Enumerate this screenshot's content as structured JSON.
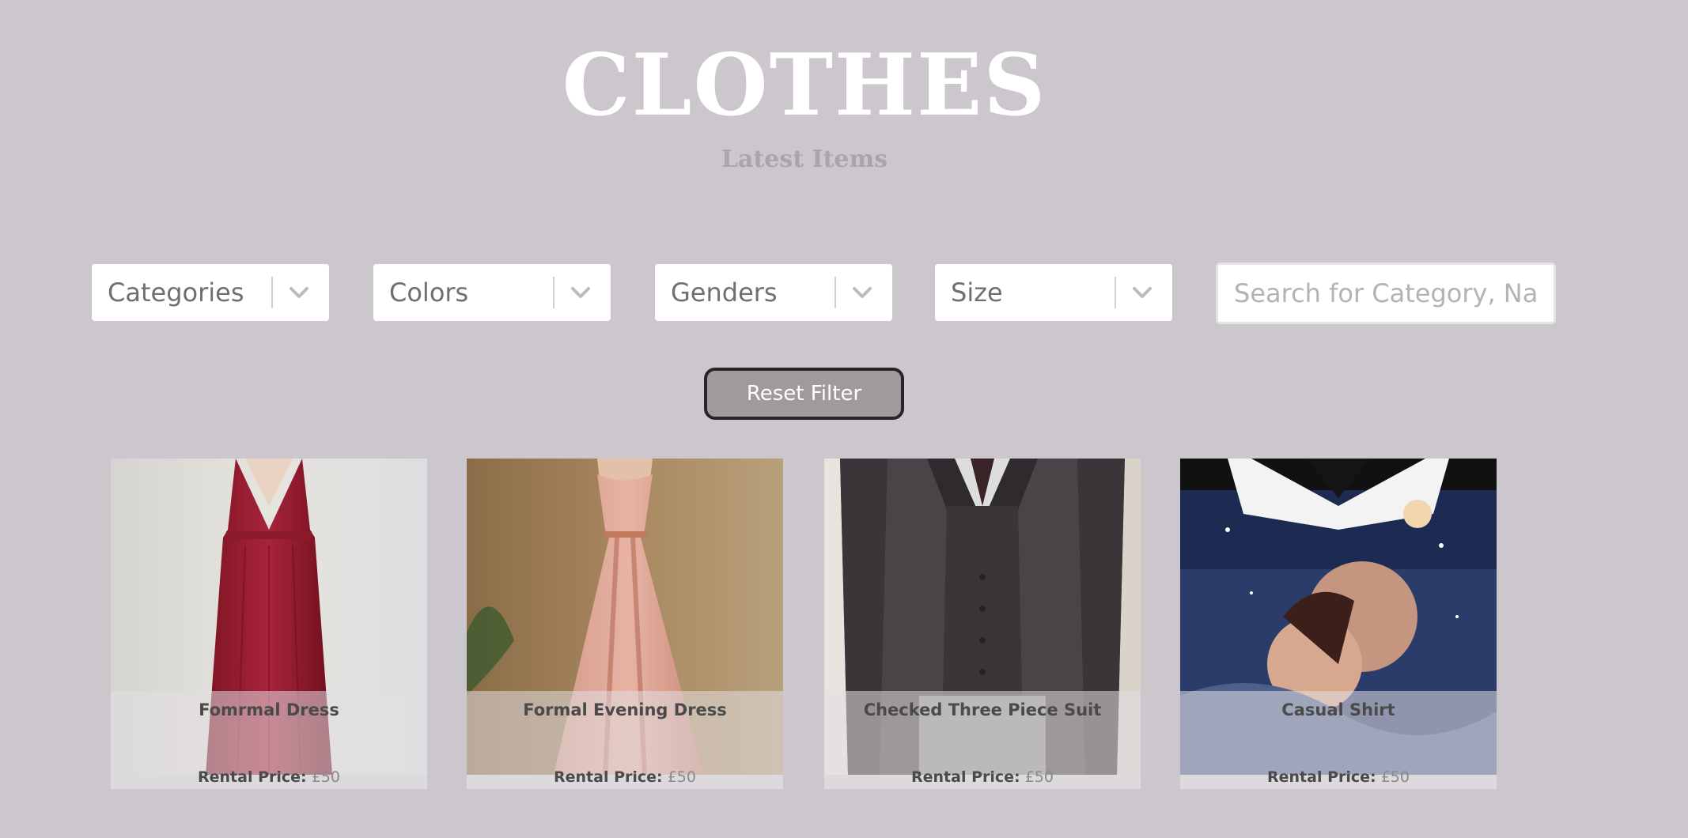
{
  "header": {
    "title": "CLOTHES",
    "subtitle": "Latest Items"
  },
  "filters": {
    "categories": {
      "label": "Categories",
      "icon": "chevron-down-icon"
    },
    "colors": {
      "label": "Colors",
      "icon": "chevron-down-icon"
    },
    "genders": {
      "label": "Genders",
      "icon": "chevron-down-icon"
    },
    "size": {
      "label": "Size",
      "icon": "chevron-down-icon"
    }
  },
  "search": {
    "placeholder": "Search for Category, Name, Company...",
    "value": ""
  },
  "reset_button": {
    "label": "Reset Filter"
  },
  "items": [
    {
      "name": "Fomrmal Dress",
      "price_label": "Rental Price:",
      "price": "£50",
      "image": "red-satin-dress"
    },
    {
      "name": "Formal Evening Dress",
      "price_label": "Rental Price:",
      "price": "£50",
      "image": "pink-evening-gown"
    },
    {
      "name": "Checked Three Piece Suit",
      "price_label": "Rental Price:",
      "price": "£50",
      "image": "grey-three-piece-suit"
    },
    {
      "name": "Casual Shirt",
      "price_label": "Rental Price:",
      "price": "£50",
      "image": "printed-casual-shirt"
    }
  ],
  "colors": {
    "background": "#ccc7cd",
    "title": "#ffffff",
    "subtitle": "#aaa4ab",
    "reset_button_bg": "#a09a9f",
    "reset_button_border": "#262626"
  }
}
